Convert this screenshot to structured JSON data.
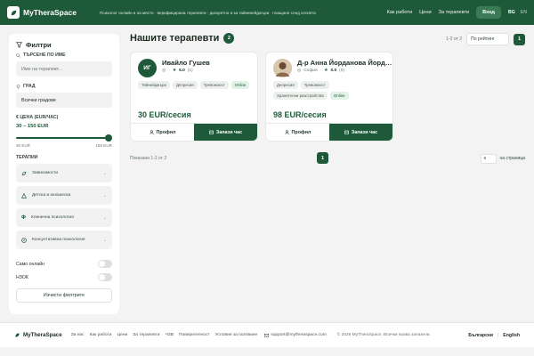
{
  "header": {
    "brand": "MyTheraSpace",
    "tagline": "Психолог онлайн и на място · верифицирана терапевти · дискретно и за тайнинейджъри · плащане след сесията",
    "nav": [
      "Как работи",
      "Цени",
      "За терапевти"
    ],
    "login": "Вход",
    "lang_active": "BG",
    "lang_other": "EN"
  },
  "filters": {
    "title": "Филтри",
    "name_label": "ТЪРСЕНЕ ПО ИМЕ",
    "name_placeholder": "Име на терапевт...",
    "city_label": "ГРАД",
    "city_value": "Всички градове",
    "price_label": "€ ЦЕНА (EUR/ЧАС)",
    "price_range": "30 – 150 EUR",
    "price_min": "30 EUR",
    "price_max": "150 EUR",
    "therapies_label": "ТЕРАПИИ",
    "therapies": [
      {
        "label": "Зависимости",
        "icon": "leaf-icon"
      },
      {
        "label": "Детска и юношеска",
        "icon": "child-icon"
      },
      {
        "label": "Клинична психология",
        "icon": "psi-icon"
      },
      {
        "label": "Консултативна психология",
        "icon": "compass-icon"
      }
    ],
    "online_only": "Само онлайн",
    "nzok": "НЗОК",
    "clear": "Изчисти филтрите"
  },
  "main": {
    "title": "Нашите терапевти",
    "count": "2",
    "result_range": "1-2 от 2",
    "sort": "По рейтинг",
    "page": "1",
    "showing": "Показани 1-2 от 2",
    "per_page_value": "6",
    "per_page_label": "на страница"
  },
  "therapists": [
    {
      "initials": "ИГ",
      "name": "Ивайло Гушев",
      "location": "",
      "rating": "5.0",
      "reviews": "(1)",
      "tags": [
        "Тийнейджъри",
        "Депресия",
        "Тревожност"
      ],
      "online": "Online",
      "price": "30 EUR/сесия",
      "profile": "Профил",
      "book": "Запази час"
    },
    {
      "initials": "",
      "name": "Д-р Анна Йорданова Йорданова",
      "location": "София",
      "rating": "0.0",
      "reviews": "(0)",
      "tags": [
        "Депресия",
        "Тревожност",
        "Хранителни разстройства"
      ],
      "online": "Online",
      "price": "98 EUR/сесия",
      "profile": "Профил",
      "book": "Запази час"
    }
  ],
  "footer": {
    "brand": "MyTheraSpace",
    "links": [
      "За нас",
      "Как работи",
      "Цени",
      "За терапевти",
      "ЧЗВ",
      "Поверителност",
      "Условия за ползване"
    ],
    "email": "support@mytheraspace.com",
    "copyright": "© 2026 MyTheraSpace. Всички права запазени.",
    "lang_bg": "Български",
    "lang_en": "English"
  },
  "colors": {
    "primary": "#1e5a3a",
    "accent_light": "#e1f2e6",
    "background": "#f2f3f2"
  }
}
